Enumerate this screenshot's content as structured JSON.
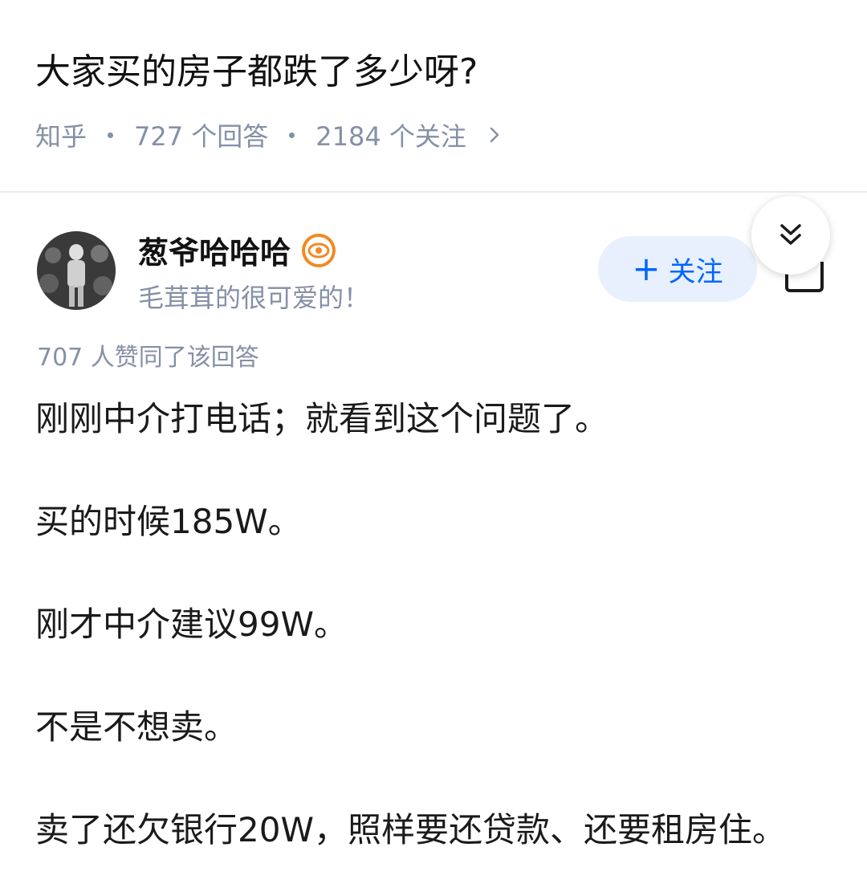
{
  "question": {
    "title": "大家买的房子都跌了多少呀?",
    "source": "知乎",
    "answers_count": "727 个回答",
    "followers_count": "2184 个关注"
  },
  "author": {
    "name": "葱爷哈哈哈",
    "bio": "毛茸茸的很可爱的！",
    "badge_icon": "eye-badge-icon",
    "avatar_icon": "avatar-photo"
  },
  "follow_button": {
    "plus": "+",
    "label": "关注"
  },
  "colors": {
    "accent_blue": "#0066ff",
    "follow_bg": "#e8f0fd",
    "meta_gray": "#8590a6",
    "badge_orange": "#f08a24"
  },
  "answer": {
    "upvotes_text": "707 人赞同了该回答",
    "paragraphs": [
      "刚刚中介打电话；就看到这个问题了。",
      "买的时候185W。",
      "刚才中介建议99W。",
      "不是不想卖。",
      "卖了还欠银行20W，照样要还贷款、还要租房住。"
    ]
  }
}
